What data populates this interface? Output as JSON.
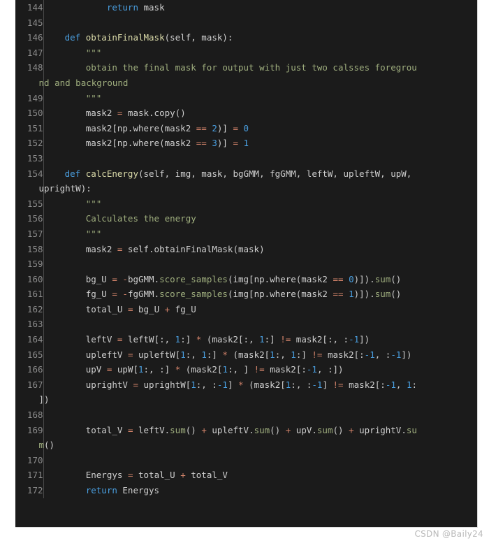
{
  "editor": {
    "language": "python",
    "theme": "dark",
    "background_color": "#1b1b1b",
    "gutter_divider_color": "#4a4a4a",
    "line_number_color": "#8b8b8b",
    "default_text_color": "#cfcfcf",
    "first_line_number": 144,
    "last_line_number": 172
  },
  "palette": {
    "keyword": "#4a9fe0",
    "function": "#dcdcaa",
    "string": "#9fae7e",
    "number": "#4a9fe0",
    "operator": "#d2836a",
    "method": "#9fae7e",
    "plain": "#cfcfcf"
  },
  "watermark": {
    "text": "CSDN @Baily24"
  },
  "lines": [
    {
      "number": "144",
      "rows": [
        {
          "indent": "            ",
          "tokens": [
            {
              "t": "return",
              "c": "kw"
            },
            {
              "t": " mask",
              "c": "txt"
            }
          ]
        }
      ]
    },
    {
      "number": "145",
      "rows": [
        {
          "indent": "",
          "tokens": []
        }
      ]
    },
    {
      "number": "146",
      "rows": [
        {
          "indent": "    ",
          "tokens": [
            {
              "t": "def",
              "c": "kw"
            },
            {
              "t": " ",
              "c": "txt"
            },
            {
              "t": "obtainFinalMask",
              "c": "fn"
            },
            {
              "t": "(self, mask):",
              "c": "txt"
            }
          ]
        }
      ]
    },
    {
      "number": "147",
      "rows": [
        {
          "indent": "        ",
          "tokens": [
            {
              "t": "\"\"\"",
              "c": "str"
            }
          ]
        }
      ]
    },
    {
      "number": "148",
      "rows": [
        {
          "indent": "        ",
          "tokens": [
            {
              "t": "obtain the final mask for output with just two calsses foregrou",
              "c": "str"
            }
          ]
        },
        {
          "indent": "",
          "cont": true,
          "tokens": [
            {
              "t": "nd and background",
              "c": "str"
            }
          ]
        }
      ]
    },
    {
      "number": "149",
      "rows": [
        {
          "indent": "        ",
          "tokens": [
            {
              "t": "\"\"\"",
              "c": "str"
            }
          ]
        }
      ]
    },
    {
      "number": "150",
      "rows": [
        {
          "indent": "        ",
          "tokens": [
            {
              "t": "mask2 ",
              "c": "txt"
            },
            {
              "t": "=",
              "c": "op"
            },
            {
              "t": " mask.copy()",
              "c": "txt"
            }
          ]
        }
      ]
    },
    {
      "number": "151",
      "rows": [
        {
          "indent": "        ",
          "tokens": [
            {
              "t": "mask2[np.where(mask2 ",
              "c": "txt"
            },
            {
              "t": "==",
              "c": "op"
            },
            {
              "t": " ",
              "c": "txt"
            },
            {
              "t": "2",
              "c": "num"
            },
            {
              "t": ")] ",
              "c": "txt"
            },
            {
              "t": "=",
              "c": "op"
            },
            {
              "t": " ",
              "c": "txt"
            },
            {
              "t": "0",
              "c": "num"
            }
          ]
        }
      ]
    },
    {
      "number": "152",
      "rows": [
        {
          "indent": "        ",
          "tokens": [
            {
              "t": "mask2[np.where(mask2 ",
              "c": "txt"
            },
            {
              "t": "==",
              "c": "op"
            },
            {
              "t": " ",
              "c": "txt"
            },
            {
              "t": "3",
              "c": "num"
            },
            {
              "t": ")] ",
              "c": "txt"
            },
            {
              "t": "=",
              "c": "op"
            },
            {
              "t": " ",
              "c": "txt"
            },
            {
              "t": "1",
              "c": "num"
            }
          ]
        }
      ]
    },
    {
      "number": "153",
      "rows": [
        {
          "indent": "",
          "tokens": []
        }
      ]
    },
    {
      "number": "154",
      "rows": [
        {
          "indent": "    ",
          "tokens": [
            {
              "t": "def",
              "c": "kw"
            },
            {
              "t": " ",
              "c": "txt"
            },
            {
              "t": "calcEnergy",
              "c": "fn"
            },
            {
              "t": "(self, img, mask, bgGMM, fgGMM, leftW, upleftW, upW,",
              "c": "txt"
            }
          ]
        },
        {
          "indent": "",
          "cont": true,
          "tokens": [
            {
              "t": "uprightW):",
              "c": "txt"
            }
          ]
        }
      ]
    },
    {
      "number": "155",
      "rows": [
        {
          "indent": "        ",
          "tokens": [
            {
              "t": "\"\"\"",
              "c": "str"
            }
          ]
        }
      ]
    },
    {
      "number": "156",
      "rows": [
        {
          "indent": "        ",
          "tokens": [
            {
              "t": "Calculates the energy",
              "c": "str"
            }
          ]
        }
      ]
    },
    {
      "number": "157",
      "rows": [
        {
          "indent": "        ",
          "tokens": [
            {
              "t": "\"\"\"",
              "c": "str"
            }
          ]
        }
      ]
    },
    {
      "number": "158",
      "rows": [
        {
          "indent": "        ",
          "tokens": [
            {
              "t": "mask2 ",
              "c": "txt"
            },
            {
              "t": "=",
              "c": "op"
            },
            {
              "t": " self.obtainFinalMask(mask)",
              "c": "txt"
            }
          ]
        }
      ]
    },
    {
      "number": "159",
      "rows": [
        {
          "indent": "",
          "tokens": []
        }
      ]
    },
    {
      "number": "160",
      "rows": [
        {
          "indent": "        ",
          "tokens": [
            {
              "t": "bg_U ",
              "c": "txt"
            },
            {
              "t": "=",
              "c": "op"
            },
            {
              "t": " ",
              "c": "txt"
            },
            {
              "t": "-",
              "c": "op"
            },
            {
              "t": "bgGMM.",
              "c": "txt"
            },
            {
              "t": "score_samples",
              "c": "meth"
            },
            {
              "t": "(img[np.where(mask2 ",
              "c": "txt"
            },
            {
              "t": "==",
              "c": "op"
            },
            {
              "t": " ",
              "c": "txt"
            },
            {
              "t": "0",
              "c": "num"
            },
            {
              "t": ")]).",
              "c": "txt"
            },
            {
              "t": "sum",
              "c": "meth"
            },
            {
              "t": "()",
              "c": "txt"
            }
          ]
        }
      ]
    },
    {
      "number": "161",
      "rows": [
        {
          "indent": "        ",
          "tokens": [
            {
              "t": "fg_U ",
              "c": "txt"
            },
            {
              "t": "=",
              "c": "op"
            },
            {
              "t": " ",
              "c": "txt"
            },
            {
              "t": "-",
              "c": "op"
            },
            {
              "t": "fgGMM.",
              "c": "txt"
            },
            {
              "t": "score_samples",
              "c": "meth"
            },
            {
              "t": "(img[np.where(mask2 ",
              "c": "txt"
            },
            {
              "t": "==",
              "c": "op"
            },
            {
              "t": " ",
              "c": "txt"
            },
            {
              "t": "1",
              "c": "num"
            },
            {
              "t": ")]).",
              "c": "txt"
            },
            {
              "t": "sum",
              "c": "meth"
            },
            {
              "t": "()",
              "c": "txt"
            }
          ]
        }
      ]
    },
    {
      "number": "162",
      "rows": [
        {
          "indent": "        ",
          "tokens": [
            {
              "t": "total_U ",
              "c": "txt"
            },
            {
              "t": "=",
              "c": "op"
            },
            {
              "t": " bg_U ",
              "c": "txt"
            },
            {
              "t": "+",
              "c": "op"
            },
            {
              "t": " fg_U",
              "c": "txt"
            }
          ]
        }
      ]
    },
    {
      "number": "163",
      "rows": [
        {
          "indent": "",
          "tokens": []
        }
      ]
    },
    {
      "number": "164",
      "rows": [
        {
          "indent": "        ",
          "tokens": [
            {
              "t": "leftV ",
              "c": "txt"
            },
            {
              "t": "=",
              "c": "op"
            },
            {
              "t": " leftW[:, ",
              "c": "txt"
            },
            {
              "t": "1",
              "c": "num"
            },
            {
              "t": ":] ",
              "c": "txt"
            },
            {
              "t": "*",
              "c": "op"
            },
            {
              "t": " (mask2[:, ",
              "c": "txt"
            },
            {
              "t": "1",
              "c": "num"
            },
            {
              "t": ":] ",
              "c": "txt"
            },
            {
              "t": "!=",
              "c": "op"
            },
            {
              "t": " mask2[:, :",
              "c": "txt"
            },
            {
              "t": "-1",
              "c": "num"
            },
            {
              "t": "])",
              "c": "txt"
            }
          ]
        }
      ]
    },
    {
      "number": "165",
      "rows": [
        {
          "indent": "        ",
          "tokens": [
            {
              "t": "upleftV ",
              "c": "txt"
            },
            {
              "t": "=",
              "c": "op"
            },
            {
              "t": " upleftW[",
              "c": "txt"
            },
            {
              "t": "1",
              "c": "num"
            },
            {
              "t": ":, ",
              "c": "txt"
            },
            {
              "t": "1",
              "c": "num"
            },
            {
              "t": ":] ",
              "c": "txt"
            },
            {
              "t": "*",
              "c": "op"
            },
            {
              "t": " (mask2[",
              "c": "txt"
            },
            {
              "t": "1",
              "c": "num"
            },
            {
              "t": ":, ",
              "c": "txt"
            },
            {
              "t": "1",
              "c": "num"
            },
            {
              "t": ":] ",
              "c": "txt"
            },
            {
              "t": "!=",
              "c": "op"
            },
            {
              "t": " mask2[:",
              "c": "txt"
            },
            {
              "t": "-1",
              "c": "num"
            },
            {
              "t": ", :",
              "c": "txt"
            },
            {
              "t": "-1",
              "c": "num"
            },
            {
              "t": "])",
              "c": "txt"
            }
          ]
        }
      ]
    },
    {
      "number": "166",
      "rows": [
        {
          "indent": "        ",
          "tokens": [
            {
              "t": "upV ",
              "c": "txt"
            },
            {
              "t": "=",
              "c": "op"
            },
            {
              "t": " upW[",
              "c": "txt"
            },
            {
              "t": "1",
              "c": "num"
            },
            {
              "t": ":, :] ",
              "c": "txt"
            },
            {
              "t": "*",
              "c": "op"
            },
            {
              "t": " (mask2[",
              "c": "txt"
            },
            {
              "t": "1",
              "c": "num"
            },
            {
              "t": ":, ] ",
              "c": "txt"
            },
            {
              "t": "!=",
              "c": "op"
            },
            {
              "t": " mask2[:",
              "c": "txt"
            },
            {
              "t": "-1",
              "c": "num"
            },
            {
              "t": ", :])",
              "c": "txt"
            }
          ]
        }
      ]
    },
    {
      "number": "167",
      "rows": [
        {
          "indent": "        ",
          "tokens": [
            {
              "t": "uprightV ",
              "c": "txt"
            },
            {
              "t": "=",
              "c": "op"
            },
            {
              "t": " uprightW[",
              "c": "txt"
            },
            {
              "t": "1",
              "c": "num"
            },
            {
              "t": ":, :",
              "c": "txt"
            },
            {
              "t": "-1",
              "c": "num"
            },
            {
              "t": "] ",
              "c": "txt"
            },
            {
              "t": "*",
              "c": "op"
            },
            {
              "t": " (mask2[",
              "c": "txt"
            },
            {
              "t": "1",
              "c": "num"
            },
            {
              "t": ":, :",
              "c": "txt"
            },
            {
              "t": "-1",
              "c": "num"
            },
            {
              "t": "] ",
              "c": "txt"
            },
            {
              "t": "!=",
              "c": "op"
            },
            {
              "t": " mask2[:",
              "c": "txt"
            },
            {
              "t": "-1",
              "c": "num"
            },
            {
              "t": ", ",
              "c": "txt"
            },
            {
              "t": "1",
              "c": "num"
            },
            {
              "t": ":",
              "c": "txt"
            }
          ]
        },
        {
          "indent": "",
          "cont": true,
          "tokens": [
            {
              "t": "])",
              "c": "txt"
            }
          ]
        }
      ]
    },
    {
      "number": "168",
      "rows": [
        {
          "indent": "",
          "tokens": []
        }
      ]
    },
    {
      "number": "169",
      "rows": [
        {
          "indent": "        ",
          "tokens": [
            {
              "t": "total_V ",
              "c": "txt"
            },
            {
              "t": "=",
              "c": "op"
            },
            {
              "t": " leftV.",
              "c": "txt"
            },
            {
              "t": "sum",
              "c": "meth"
            },
            {
              "t": "() ",
              "c": "txt"
            },
            {
              "t": "+",
              "c": "op"
            },
            {
              "t": " upleftV.",
              "c": "txt"
            },
            {
              "t": "sum",
              "c": "meth"
            },
            {
              "t": "() ",
              "c": "txt"
            },
            {
              "t": "+",
              "c": "op"
            },
            {
              "t": " upV.",
              "c": "txt"
            },
            {
              "t": "sum",
              "c": "meth"
            },
            {
              "t": "() ",
              "c": "txt"
            },
            {
              "t": "+",
              "c": "op"
            },
            {
              "t": " uprightV.",
              "c": "txt"
            },
            {
              "t": "su",
              "c": "meth"
            }
          ]
        },
        {
          "indent": "",
          "cont": true,
          "tokens": [
            {
              "t": "m",
              "c": "meth"
            },
            {
              "t": "()",
              "c": "txt"
            }
          ]
        }
      ]
    },
    {
      "number": "170",
      "rows": [
        {
          "indent": "",
          "tokens": []
        }
      ]
    },
    {
      "number": "171",
      "rows": [
        {
          "indent": "        ",
          "tokens": [
            {
              "t": "Energys ",
              "c": "txt"
            },
            {
              "t": "=",
              "c": "op"
            },
            {
              "t": " total_U ",
              "c": "txt"
            },
            {
              "t": "+",
              "c": "op"
            },
            {
              "t": " total_V",
              "c": "txt"
            }
          ]
        }
      ]
    },
    {
      "number": "172",
      "rows": [
        {
          "indent": "        ",
          "tokens": [
            {
              "t": "return",
              "c": "kw"
            },
            {
              "t": " Energys",
              "c": "txt"
            }
          ]
        }
      ]
    }
  ]
}
